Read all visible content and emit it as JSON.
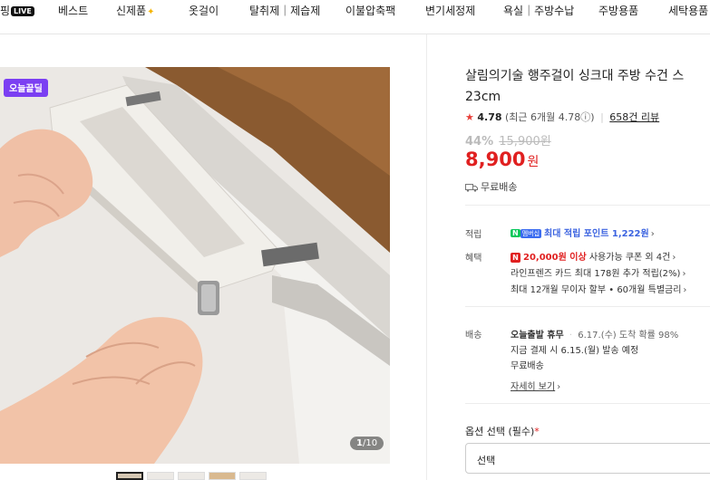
{
  "nav": {
    "live_text": "핑",
    "live_badge": "LIVE",
    "items": [
      "베스트",
      "신제품",
      "옷걸이",
      "탈취제｜제습제",
      "이불압축팩",
      "변기세정제",
      "욕실｜주방수납",
      "주방용품",
      "세탁용품"
    ],
    "new_icon": "sparkle-icon"
  },
  "image": {
    "badge": "오늘끝딜",
    "counter_current": "1",
    "counter_total": "/10",
    "thumbnail_count": 5
  },
  "product": {
    "title_line1": "살림의기술 행주걸이 싱크대 주방 수건 스",
    "title_line2": "23cm",
    "rating": "4.78",
    "recent_rating": "(최근 6개월 4.78",
    "info_icon": "ⓘ",
    "recent_close": ")",
    "reviews": "658건 리뷰",
    "discount_rate": "44%",
    "original_price": "15,900원",
    "price": "8,900",
    "price_unit": "원",
    "shipping": "무료배송"
  },
  "benefits": {
    "points_label": "적립",
    "npay_n": "N",
    "npay_plus": "멤버십",
    "points_text": "최대 적립 포인트 1,222원",
    "benefit_label": "혜택",
    "coupon_strong": "20,000원 이상",
    "coupon_text": "사용가능 쿠폰 외 4건",
    "card_text": "라인프렌즈 카드 최대 178원 추가 적립(2%)",
    "installment_text": "최대 12개월 무이자 할부 • 60개월 특별금리"
  },
  "delivery": {
    "label": "배송",
    "line1_strong": "오늘출발 휴무",
    "line1_date": "6.17.(수) 도착 확률 98%",
    "line2": "지금 결제 시 6.15.(월) 발송 예정",
    "line3": "무료배송",
    "detail_link": "자세히 보기"
  },
  "option": {
    "label": "옵션 선택 (필수)",
    "required": "*",
    "select_value": "선택"
  },
  "colors": {
    "price_red": "#e02020",
    "badge_purple": "#7b3ff2",
    "point_blue": "#3b63e0",
    "npay_green": "#03c75a"
  }
}
